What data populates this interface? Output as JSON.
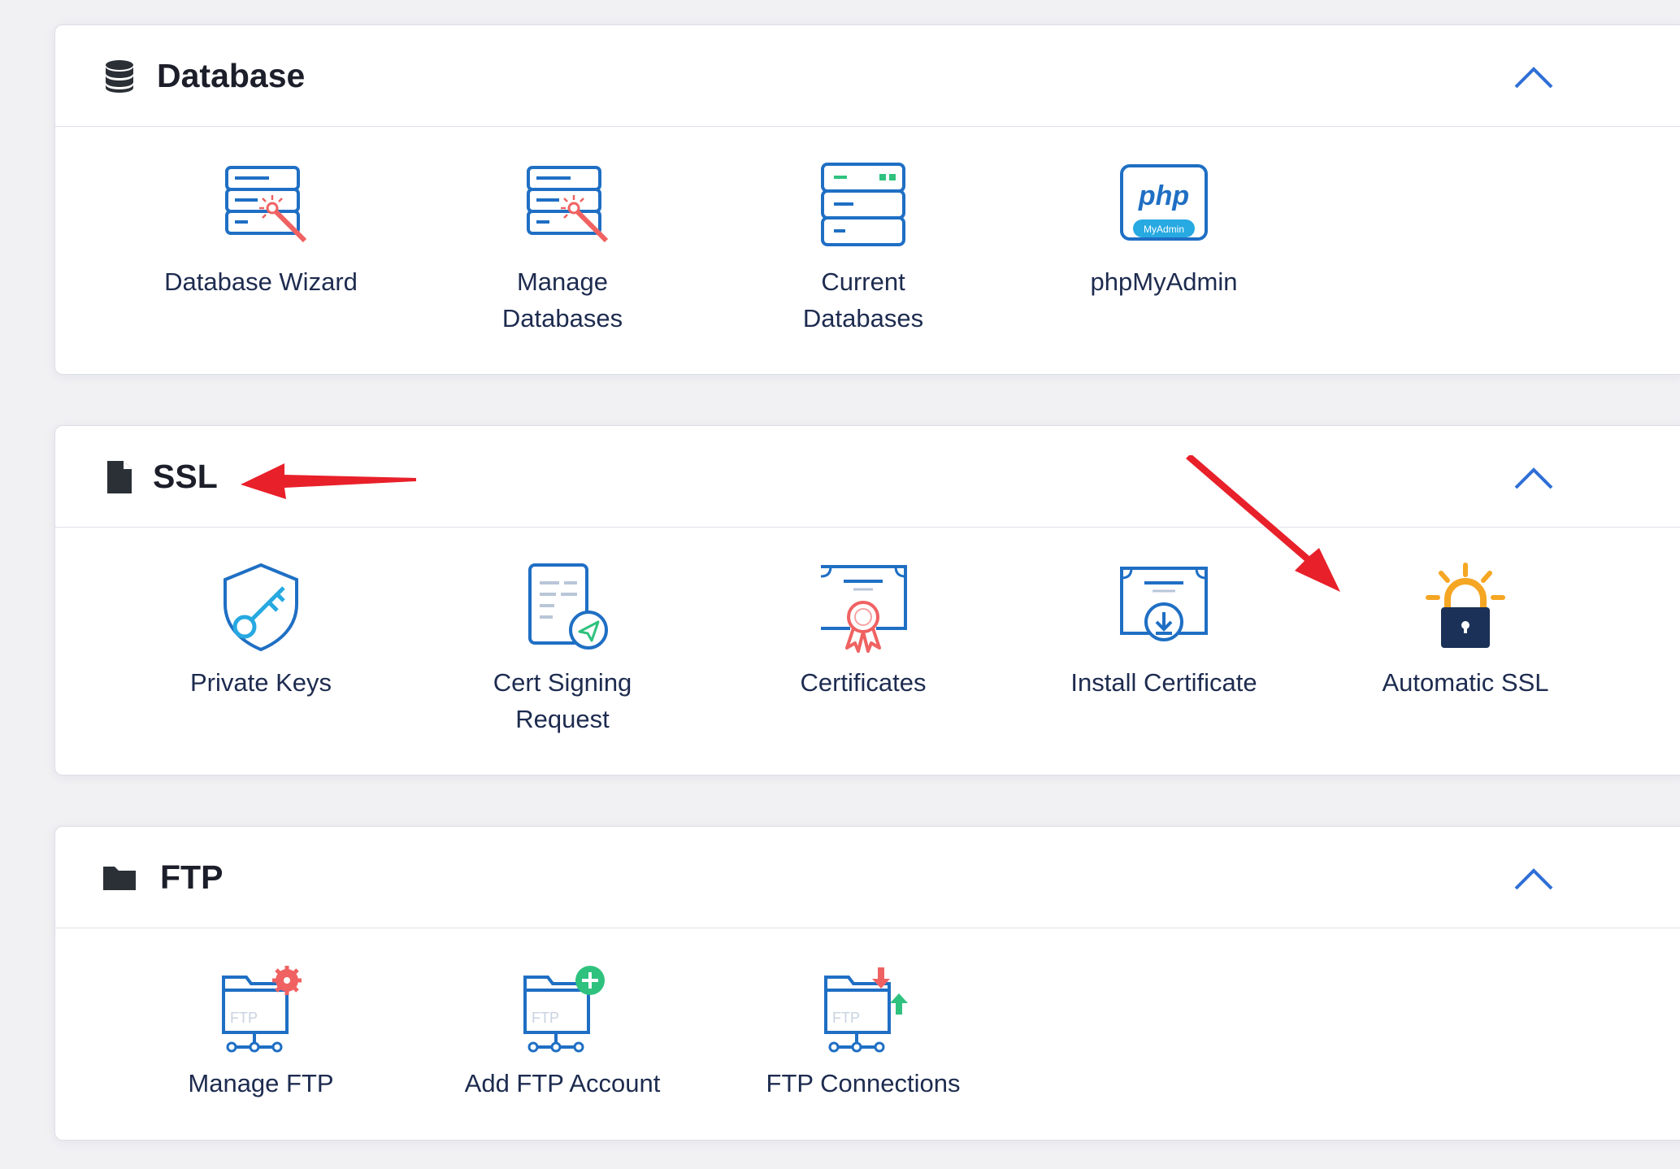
{
  "sections": [
    {
      "title": "Database",
      "header_icon": "database-icon",
      "collapse_icon": "chevron-up-icon",
      "items": [
        {
          "label": "Database Wizard",
          "icon": "database-wizard-icon"
        },
        {
          "label": "Manage Databases",
          "icon": "manage-databases-icon"
        },
        {
          "label": "Current Databases",
          "icon": "current-databases-icon"
        },
        {
          "label": "phpMyAdmin",
          "icon": "phpmyadmin-icon",
          "icon_text": "php",
          "icon_subtext": "MyAdmin"
        }
      ]
    },
    {
      "title": "SSL",
      "header_icon": "file-icon",
      "collapse_icon": "chevron-up-icon",
      "items": [
        {
          "label": "Private Keys",
          "icon": "shield-key-icon"
        },
        {
          "label": "Cert Signing Request",
          "icon": "cert-signing-request-icon"
        },
        {
          "label": "Certificates",
          "icon": "certificate-ribbon-icon"
        },
        {
          "label": "Install Certificate",
          "icon": "install-certificate-icon"
        },
        {
          "label": "Automatic SSL",
          "icon": "padlock-alert-icon"
        }
      ]
    },
    {
      "title": "FTP",
      "header_icon": "folder-icon",
      "collapse_icon": "chevron-up-icon",
      "items": [
        {
          "label": "Manage FTP",
          "icon": "ftp-gear-icon",
          "icon_text": "FTP"
        },
        {
          "label": "Add FTP Account",
          "icon": "ftp-add-icon",
          "icon_text": "FTP"
        },
        {
          "label": "FTP Connections",
          "icon": "ftp-transfer-icon",
          "icon_text": "FTP"
        }
      ]
    }
  ],
  "annotations": [
    {
      "type": "arrow",
      "color": "#e8202a",
      "points_to": "SSL section title"
    },
    {
      "type": "arrow",
      "color": "#e8202a",
      "points_to": "Automatic SSL item"
    }
  ],
  "colors": {
    "icon_blue": "#1f6fc4",
    "icon_light_blue": "#27a9e1",
    "accent_red": "#f06262",
    "accent_green": "#2ec27e",
    "accent_orange": "#f5a623",
    "lock_navy": "#1b3157",
    "collapse_chevron": "#2f6fd6",
    "annotation_red": "#e8202a"
  }
}
